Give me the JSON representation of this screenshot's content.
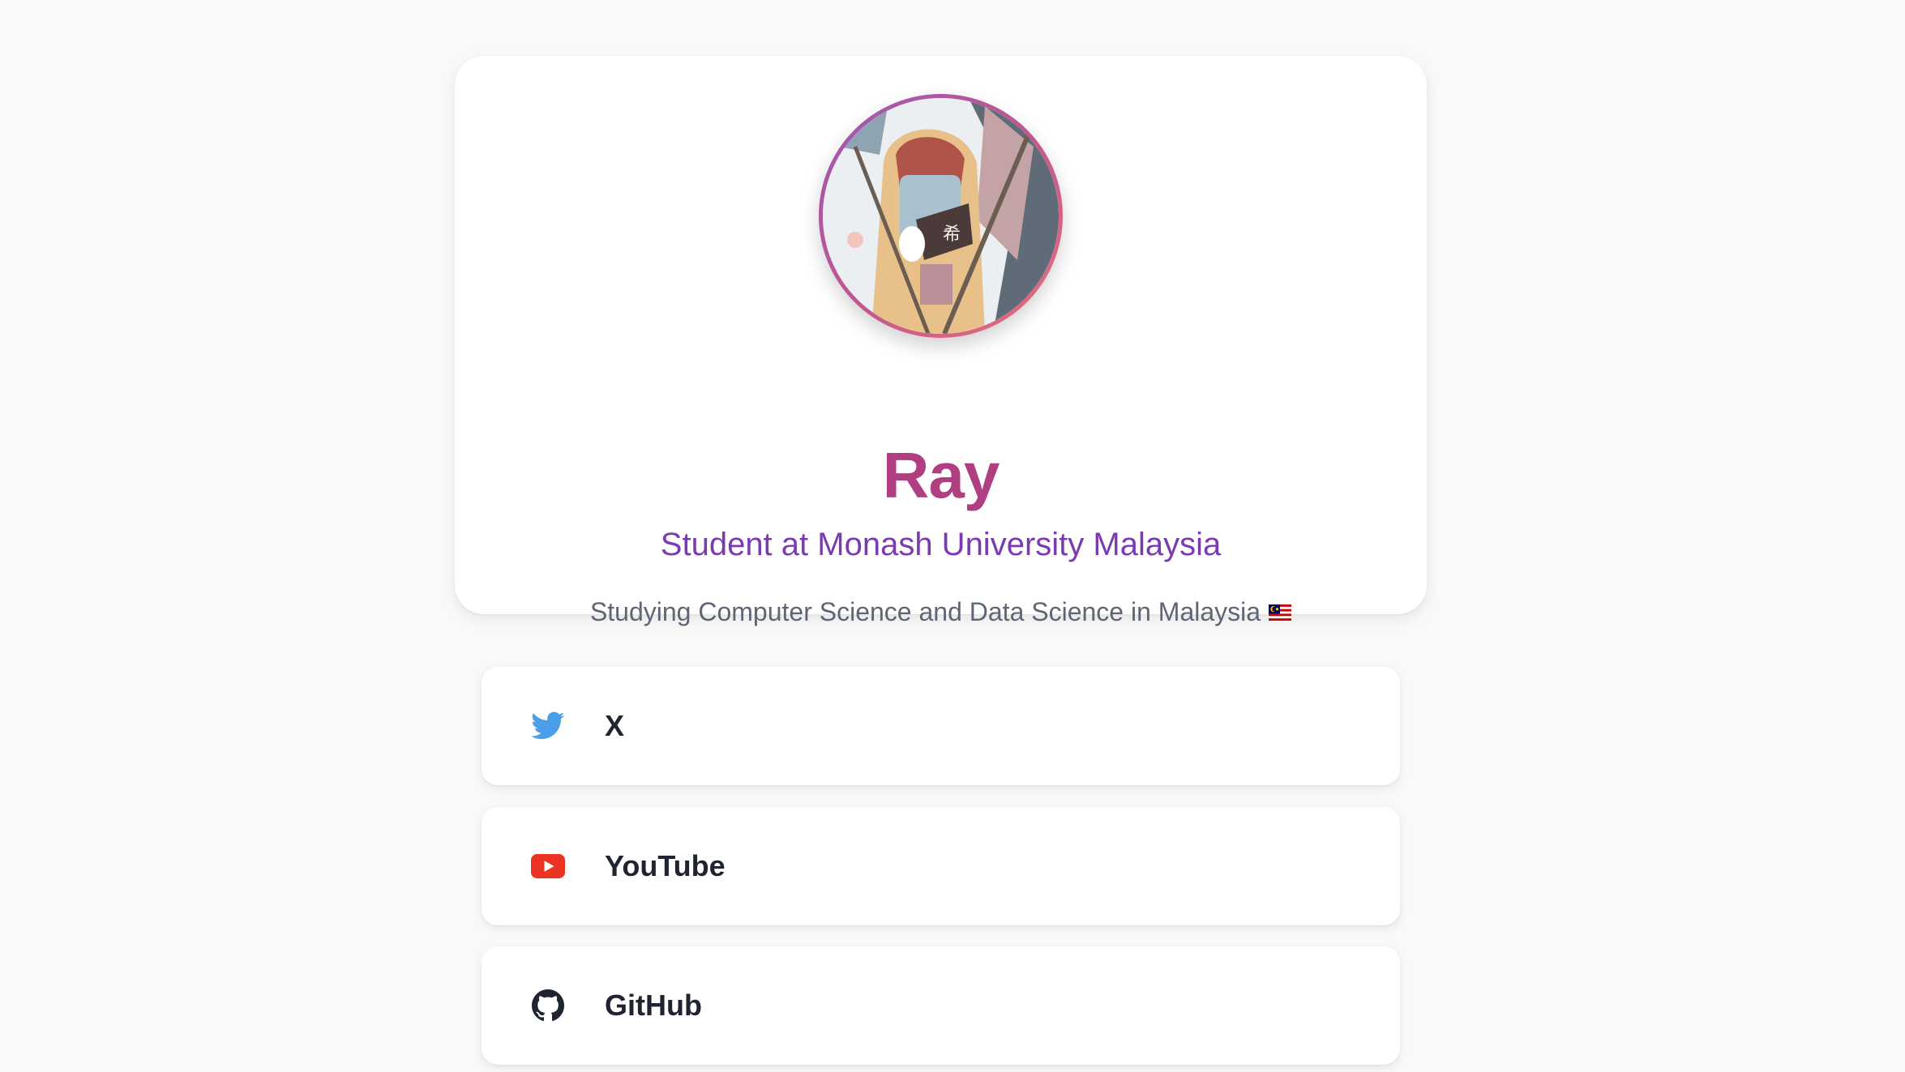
{
  "profile": {
    "name": "Ray",
    "subtitle": "Student at Monash University Malaysia",
    "bio": "Studying Computer Science and Data Science in Malaysia",
    "flag_icon": "malaysia-flag-icon"
  },
  "links": [
    {
      "label": "X",
      "icon": "twitter-bird-icon",
      "color": "#4a9fe8"
    },
    {
      "label": "YouTube",
      "icon": "youtube-icon",
      "color": "#ea3323"
    },
    {
      "label": "GitHub",
      "icon": "github-icon",
      "color": "#1f2430"
    }
  ],
  "colors": {
    "name": "#b03f82",
    "subtitle": "#7a3ab2",
    "bio": "#5e6676",
    "background": "#f9f9f9"
  }
}
